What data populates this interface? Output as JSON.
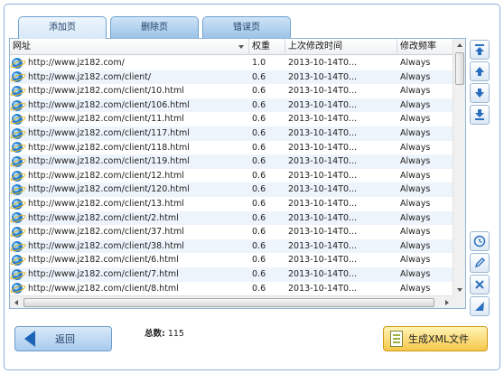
{
  "tabs": [
    {
      "label": "添加页",
      "active": true
    },
    {
      "label": "删除页",
      "active": false
    },
    {
      "label": "错误页",
      "active": false
    }
  ],
  "table": {
    "columns": [
      "网址",
      "权重",
      "上次修改时间",
      "修改频率"
    ],
    "rows": [
      {
        "url": "http://www.jz182.com/",
        "priority": "1.0",
        "modified": "2013-10-14T0...",
        "freq": "Always"
      },
      {
        "url": "http://www.jz182.com/client/",
        "priority": "0.6",
        "modified": "2013-10-14T0...",
        "freq": "Always"
      },
      {
        "url": "http://www.jz182.com/client/10.html",
        "priority": "0.6",
        "modified": "2013-10-14T0...",
        "freq": "Always"
      },
      {
        "url": "http://www.jz182.com/client/106.html",
        "priority": "0.6",
        "modified": "2013-10-14T0...",
        "freq": "Always"
      },
      {
        "url": "http://www.jz182.com/client/11.html",
        "priority": "0.6",
        "modified": "2013-10-14T0...",
        "freq": "Always"
      },
      {
        "url": "http://www.jz182.com/client/117.html",
        "priority": "0.6",
        "modified": "2013-10-14T0...",
        "freq": "Always"
      },
      {
        "url": "http://www.jz182.com/client/118.html",
        "priority": "0.6",
        "modified": "2013-10-14T0...",
        "freq": "Always"
      },
      {
        "url": "http://www.jz182.com/client/119.html",
        "priority": "0.6",
        "modified": "2013-10-14T0...",
        "freq": "Always"
      },
      {
        "url": "http://www.jz182.com/client/12.html",
        "priority": "0.6",
        "modified": "2013-10-14T0...",
        "freq": "Always"
      },
      {
        "url": "http://www.jz182.com/client/120.html",
        "priority": "0.6",
        "modified": "2013-10-14T0...",
        "freq": "Always"
      },
      {
        "url": "http://www.jz182.com/client/13.html",
        "priority": "0.6",
        "modified": "2013-10-14T0...",
        "freq": "Always"
      },
      {
        "url": "http://www.jz182.com/client/2.html",
        "priority": "0.6",
        "modified": "2013-10-14T0...",
        "freq": "Always"
      },
      {
        "url": "http://www.jz182.com/client/37.html",
        "priority": "0.6",
        "modified": "2013-10-14T0...",
        "freq": "Always"
      },
      {
        "url": "http://www.jz182.com/client/38.html",
        "priority": "0.6",
        "modified": "2013-10-14T0...",
        "freq": "Always"
      },
      {
        "url": "http://www.jz182.com/client/6.html",
        "priority": "0.6",
        "modified": "2013-10-14T0...",
        "freq": "Always"
      },
      {
        "url": "http://www.jz182.com/client/7.html",
        "priority": "0.6",
        "modified": "2013-10-14T0...",
        "freq": "Always"
      },
      {
        "url": "http://www.jz182.com/client/8.html",
        "priority": "0.6",
        "modified": "2013-10-14T0...",
        "freq": "Always"
      }
    ]
  },
  "side_tools": {
    "top": [
      "move-top-icon",
      "move-up-icon",
      "move-down-icon",
      "move-bottom-icon"
    ],
    "bottom": [
      "clock-icon",
      "edit-icon",
      "delete-icon",
      "send-icon"
    ]
  },
  "footer": {
    "back_label": "返回",
    "total_label": "总数:",
    "total_value": "115",
    "generate_label": "生成XML文件"
  }
}
